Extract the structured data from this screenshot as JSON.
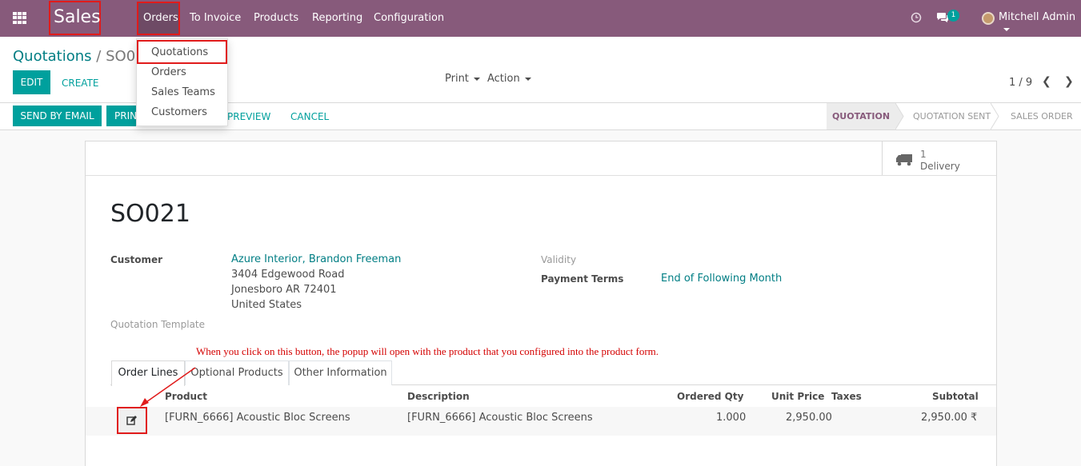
{
  "navbar": {
    "brand": "Sales",
    "menu": [
      "Orders",
      "To Invoice",
      "Products",
      "Reporting",
      "Configuration"
    ],
    "messages_count": "1",
    "user": "Mitchell Admin"
  },
  "orders_menu": [
    "Quotations",
    "Orders",
    "Sales Teams",
    "Customers"
  ],
  "breadcrumb": {
    "parent": "Quotations",
    "separator": "/",
    "current": "SO02"
  },
  "control": {
    "edit": "EDIT",
    "create": "CREATE",
    "print": "Print",
    "action": "Action",
    "pager": "1 / 9"
  },
  "actions": {
    "send_email": "SEND BY EMAIL",
    "print": "PRINT",
    "preview": "PREVIEW",
    "cancel": "CANCEL"
  },
  "statusbar": [
    "QUOTATION",
    "QUOTATION SENT",
    "SALES ORDER"
  ],
  "smart_button": {
    "count": "1",
    "label": "Delivery"
  },
  "form": {
    "title": "SO021",
    "customer_label": "Customer",
    "customer_name": "Azure Interior, Brandon Freeman",
    "address_line1": "3404 Edgewood Road",
    "address_line2": "Jonesboro AR 72401",
    "address_line3": "United States",
    "template_label": "Quotation Template",
    "validity_label": "Validity",
    "payment_terms_label": "Payment Terms",
    "payment_terms_value": "End of Following Month"
  },
  "annotation": "When you click on this button, the popup will open with the product that you configured into the product form.",
  "tabs": [
    "Order Lines",
    "Optional Products",
    "Other Information"
  ],
  "table": {
    "headers": [
      "Product",
      "Description",
      "Ordered Qty",
      "Unit Price",
      "Taxes",
      "Subtotal"
    ],
    "rows": [
      {
        "product": "[FURN_6666] Acoustic Bloc Screens",
        "description": "[FURN_6666] Acoustic Bloc Screens",
        "qty": "1.000",
        "unit_price": "2,950.00",
        "taxes": "",
        "subtotal": "2,950.00 ₹"
      }
    ]
  },
  "colors": {
    "navbar": "#875a7b",
    "primary": "#00a09d",
    "link": "#017e84",
    "highlight": "#e01b1b"
  }
}
